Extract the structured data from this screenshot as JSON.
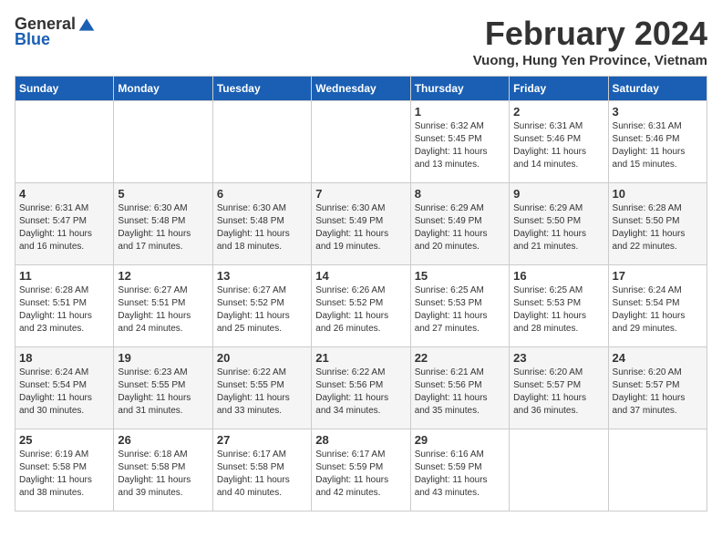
{
  "logo": {
    "general": "General",
    "blue": "Blue"
  },
  "header": {
    "month": "February 2024",
    "location": "Vuong, Hung Yen Province, Vietnam"
  },
  "weekdays": [
    "Sunday",
    "Monday",
    "Tuesday",
    "Wednesday",
    "Thursday",
    "Friday",
    "Saturday"
  ],
  "weeks": [
    [
      {
        "day": "",
        "info": ""
      },
      {
        "day": "",
        "info": ""
      },
      {
        "day": "",
        "info": ""
      },
      {
        "day": "",
        "info": ""
      },
      {
        "day": "1",
        "info": "Sunrise: 6:32 AM\nSunset: 5:45 PM\nDaylight: 11 hours\nand 13 minutes."
      },
      {
        "day": "2",
        "info": "Sunrise: 6:31 AM\nSunset: 5:46 PM\nDaylight: 11 hours\nand 14 minutes."
      },
      {
        "day": "3",
        "info": "Sunrise: 6:31 AM\nSunset: 5:46 PM\nDaylight: 11 hours\nand 15 minutes."
      }
    ],
    [
      {
        "day": "4",
        "info": "Sunrise: 6:31 AM\nSunset: 5:47 PM\nDaylight: 11 hours\nand 16 minutes."
      },
      {
        "day": "5",
        "info": "Sunrise: 6:30 AM\nSunset: 5:48 PM\nDaylight: 11 hours\nand 17 minutes."
      },
      {
        "day": "6",
        "info": "Sunrise: 6:30 AM\nSunset: 5:48 PM\nDaylight: 11 hours\nand 18 minutes."
      },
      {
        "day": "7",
        "info": "Sunrise: 6:30 AM\nSunset: 5:49 PM\nDaylight: 11 hours\nand 19 minutes."
      },
      {
        "day": "8",
        "info": "Sunrise: 6:29 AM\nSunset: 5:49 PM\nDaylight: 11 hours\nand 20 minutes."
      },
      {
        "day": "9",
        "info": "Sunrise: 6:29 AM\nSunset: 5:50 PM\nDaylight: 11 hours\nand 21 minutes."
      },
      {
        "day": "10",
        "info": "Sunrise: 6:28 AM\nSunset: 5:50 PM\nDaylight: 11 hours\nand 22 minutes."
      }
    ],
    [
      {
        "day": "11",
        "info": "Sunrise: 6:28 AM\nSunset: 5:51 PM\nDaylight: 11 hours\nand 23 minutes."
      },
      {
        "day": "12",
        "info": "Sunrise: 6:27 AM\nSunset: 5:51 PM\nDaylight: 11 hours\nand 24 minutes."
      },
      {
        "day": "13",
        "info": "Sunrise: 6:27 AM\nSunset: 5:52 PM\nDaylight: 11 hours\nand 25 minutes."
      },
      {
        "day": "14",
        "info": "Sunrise: 6:26 AM\nSunset: 5:52 PM\nDaylight: 11 hours\nand 26 minutes."
      },
      {
        "day": "15",
        "info": "Sunrise: 6:25 AM\nSunset: 5:53 PM\nDaylight: 11 hours\nand 27 minutes."
      },
      {
        "day": "16",
        "info": "Sunrise: 6:25 AM\nSunset: 5:53 PM\nDaylight: 11 hours\nand 28 minutes."
      },
      {
        "day": "17",
        "info": "Sunrise: 6:24 AM\nSunset: 5:54 PM\nDaylight: 11 hours\nand 29 minutes."
      }
    ],
    [
      {
        "day": "18",
        "info": "Sunrise: 6:24 AM\nSunset: 5:54 PM\nDaylight: 11 hours\nand 30 minutes."
      },
      {
        "day": "19",
        "info": "Sunrise: 6:23 AM\nSunset: 5:55 PM\nDaylight: 11 hours\nand 31 minutes."
      },
      {
        "day": "20",
        "info": "Sunrise: 6:22 AM\nSunset: 5:55 PM\nDaylight: 11 hours\nand 33 minutes."
      },
      {
        "day": "21",
        "info": "Sunrise: 6:22 AM\nSunset: 5:56 PM\nDaylight: 11 hours\nand 34 minutes."
      },
      {
        "day": "22",
        "info": "Sunrise: 6:21 AM\nSunset: 5:56 PM\nDaylight: 11 hours\nand 35 minutes."
      },
      {
        "day": "23",
        "info": "Sunrise: 6:20 AM\nSunset: 5:57 PM\nDaylight: 11 hours\nand 36 minutes."
      },
      {
        "day": "24",
        "info": "Sunrise: 6:20 AM\nSunset: 5:57 PM\nDaylight: 11 hours\nand 37 minutes."
      }
    ],
    [
      {
        "day": "25",
        "info": "Sunrise: 6:19 AM\nSunset: 5:58 PM\nDaylight: 11 hours\nand 38 minutes."
      },
      {
        "day": "26",
        "info": "Sunrise: 6:18 AM\nSunset: 5:58 PM\nDaylight: 11 hours\nand 39 minutes."
      },
      {
        "day": "27",
        "info": "Sunrise: 6:17 AM\nSunset: 5:58 PM\nDaylight: 11 hours\nand 40 minutes."
      },
      {
        "day": "28",
        "info": "Sunrise: 6:17 AM\nSunset: 5:59 PM\nDaylight: 11 hours\nand 42 minutes."
      },
      {
        "day": "29",
        "info": "Sunrise: 6:16 AM\nSunset: 5:59 PM\nDaylight: 11 hours\nand 43 minutes."
      },
      {
        "day": "",
        "info": ""
      },
      {
        "day": "",
        "info": ""
      }
    ]
  ]
}
